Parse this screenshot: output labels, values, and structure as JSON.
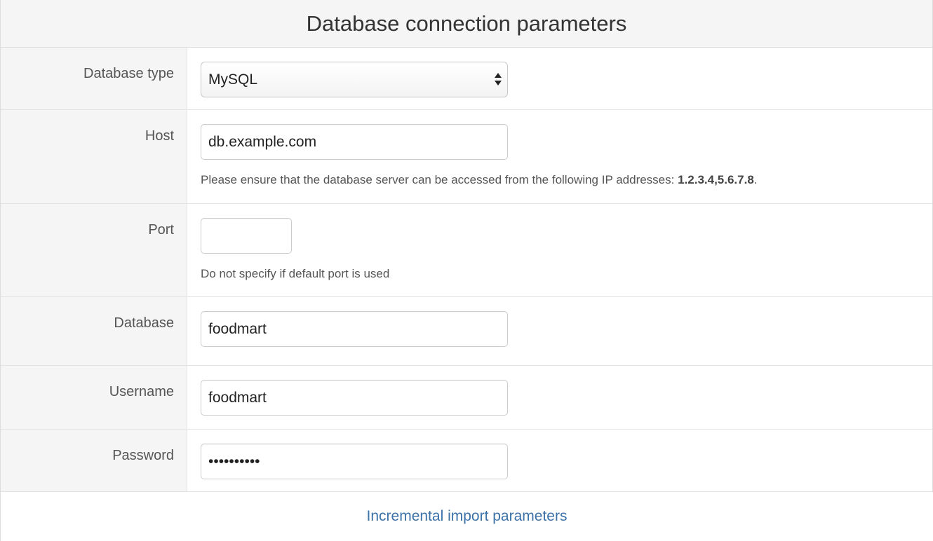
{
  "header": {
    "title": "Database connection parameters"
  },
  "fields": {
    "database_type": {
      "label": "Database type",
      "value": "MySQL"
    },
    "host": {
      "label": "Host",
      "value": "db.example.com",
      "help_prefix": "Please ensure that the database server can be accessed from the following IP addresses: ",
      "help_ips": "1.2.3.4,5.6.7.8",
      "help_suffix": "."
    },
    "port": {
      "label": "Port",
      "value": "",
      "help": "Do not specify if default port is used"
    },
    "database": {
      "label": "Database",
      "value": "foodmart"
    },
    "username": {
      "label": "Username",
      "value": "foodmart"
    },
    "password": {
      "label": "Password",
      "value": "••••••••••"
    }
  },
  "footer": {
    "link_label": "Incremental import parameters",
    "link_color": "#3b72a8"
  },
  "icons": {
    "select_arrows": "updown-arrows-icon"
  }
}
